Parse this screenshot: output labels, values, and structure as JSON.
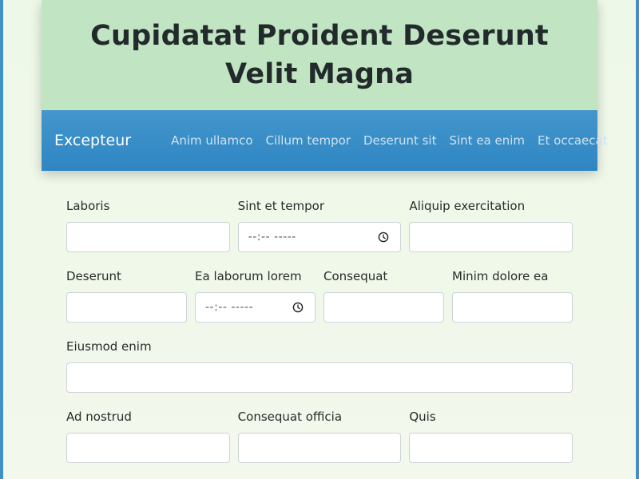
{
  "header": {
    "title": "Cupidatat Proident Deserunt Velit Magna"
  },
  "nav": {
    "brand": "Excepteur",
    "links": [
      "Anim ullamco",
      "Cillum tempor",
      "Deserunt sit",
      "Sint ea enim",
      "Et occaecat"
    ]
  },
  "form": {
    "row1": {
      "f1": "Laboris",
      "f2": "Sint et tempor",
      "f3": "Aliquip exercitation"
    },
    "row2": {
      "f1": "Deserunt",
      "f2": "Ea laborum lorem",
      "f3": "Consequat",
      "f4": "Minim dolore ea"
    },
    "row3": {
      "f1": "Eiusmod enim"
    },
    "row4": {
      "f1": "Ad nostrud",
      "f2": "Consequat officia",
      "f3": "Quis"
    },
    "time_placeholder": "--:-- -----"
  },
  "icons": {
    "time": "clock-icon"
  }
}
